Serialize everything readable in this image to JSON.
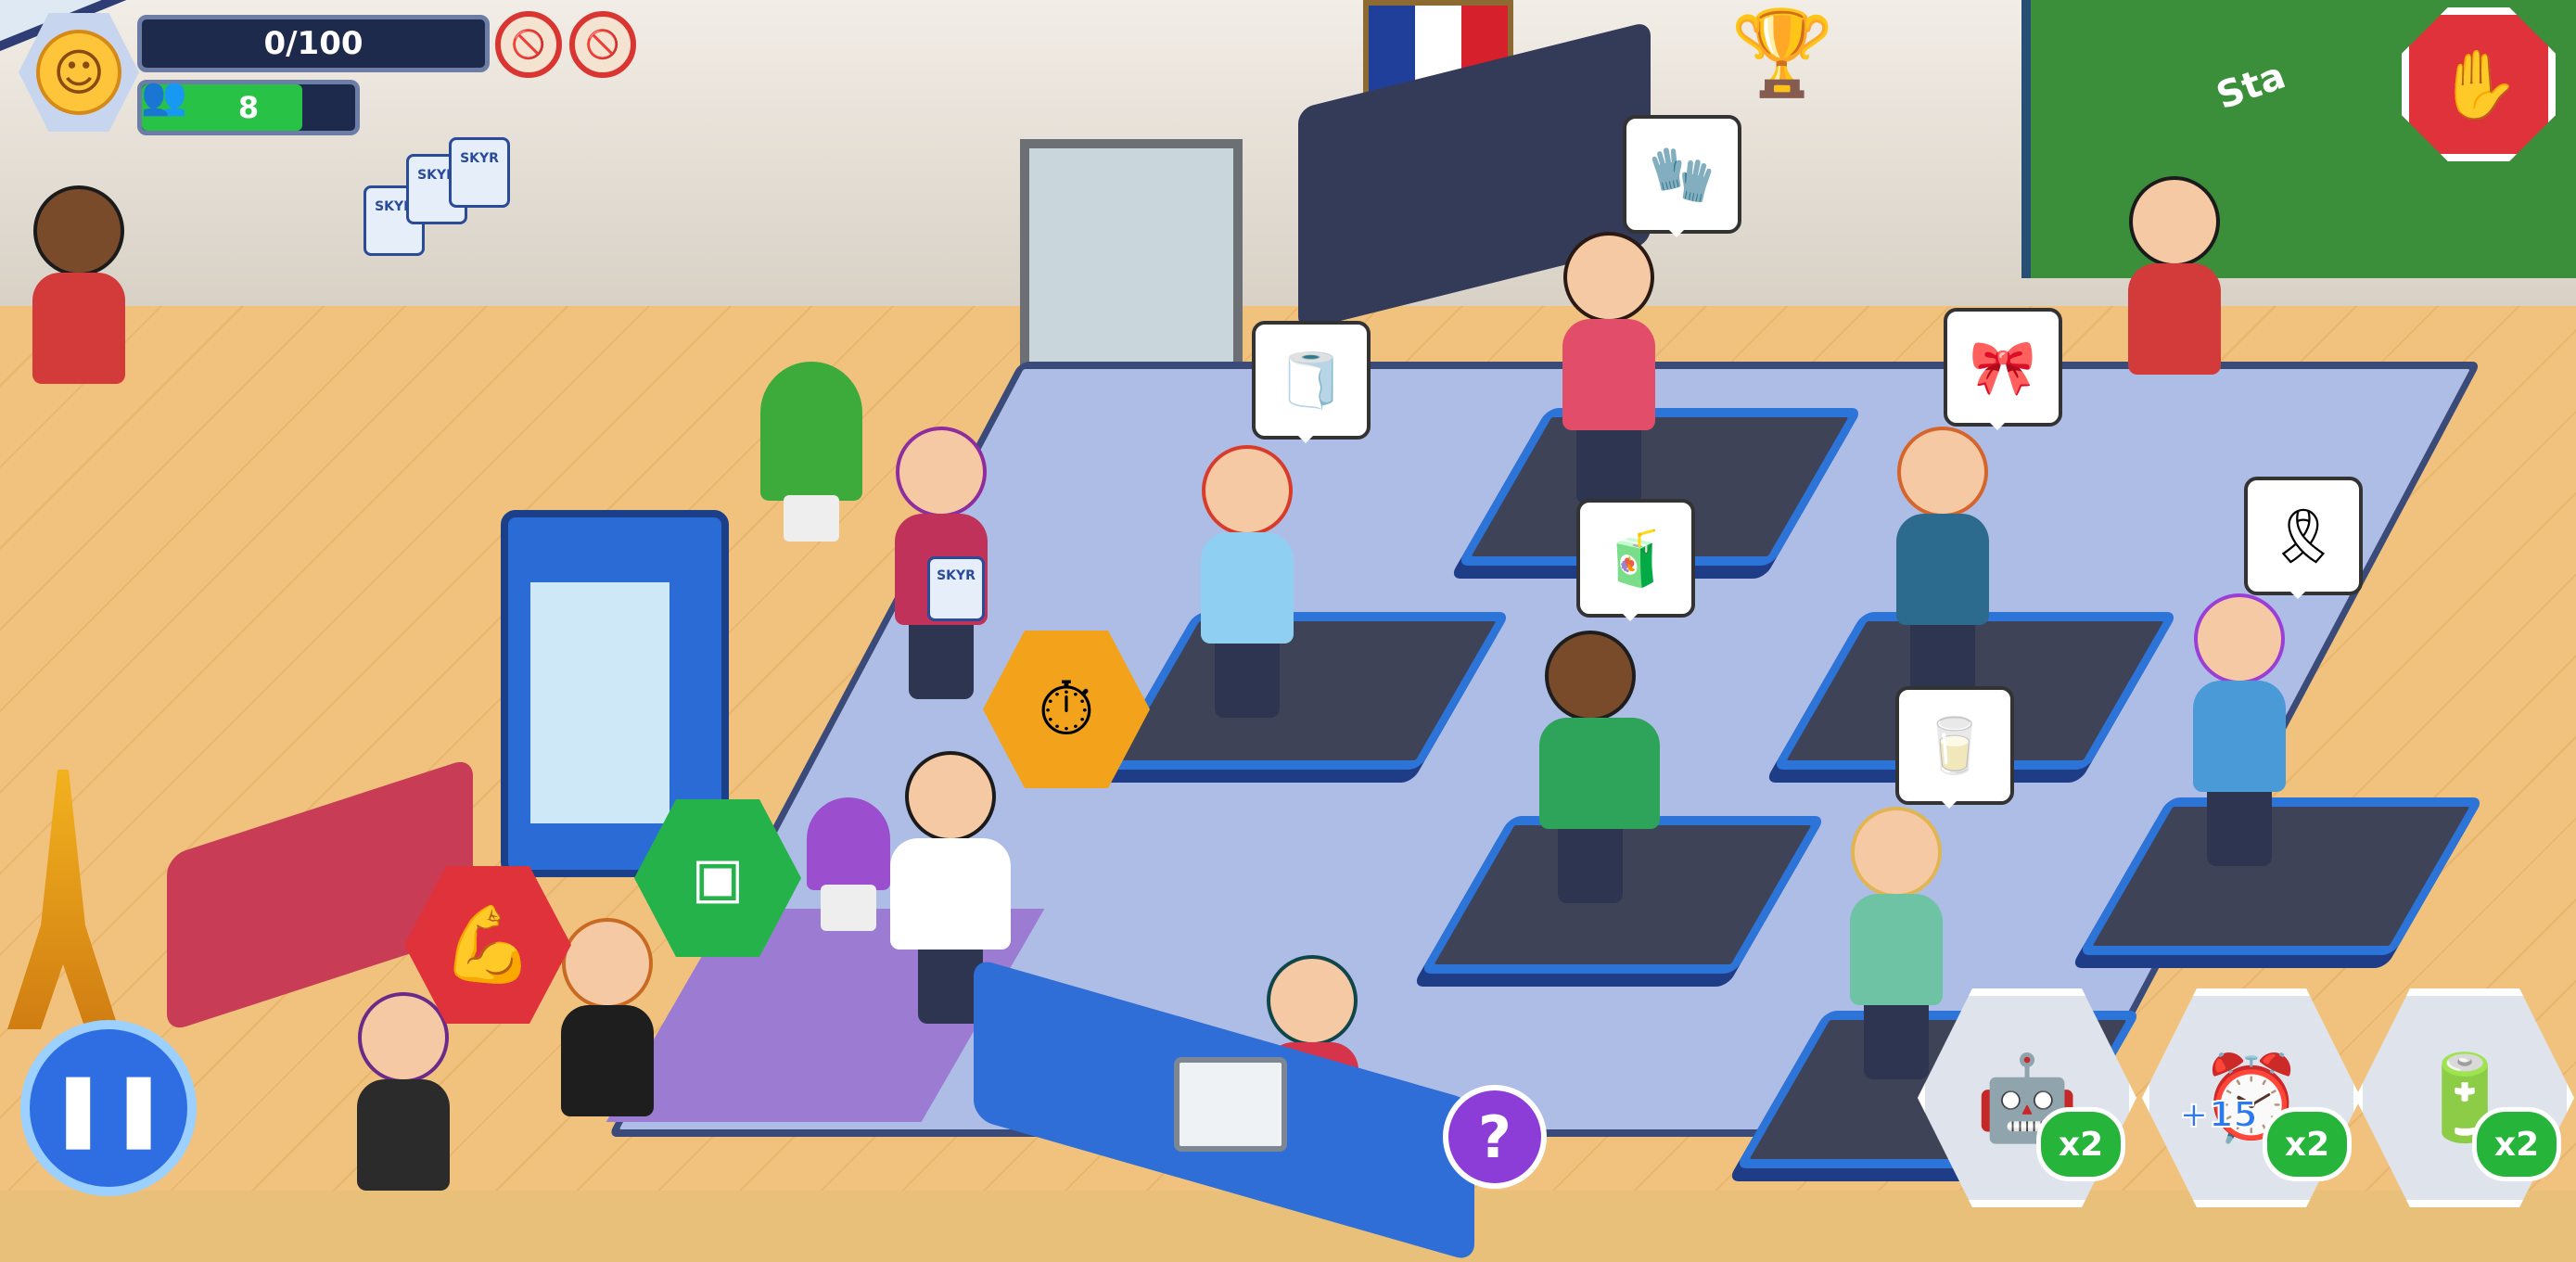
{
  "hud": {
    "xp_text": "0/100",
    "xp_progress": 0,
    "visitor_count": "8",
    "visitor_progress": 0.75,
    "avatar_icon": "smiley-face-icon",
    "no_entry_icons": [
      "no-visitor-icon",
      "no-card-icon"
    ]
  },
  "controls": {
    "stop_icon": "hand-stop-icon",
    "pause_icon": "pause-icon",
    "help_label": "?"
  },
  "skill_badges": [
    {
      "name": "strength-badge",
      "color": "#e0323b",
      "icon": "muscle-arm-icon"
    },
    {
      "name": "abs-badge",
      "color": "#26b24b",
      "icon": "abs-torso-icon"
    },
    {
      "name": "cardio-timer-badge",
      "color": "#f2a31b",
      "icon": "stopwatch-plus-icon"
    }
  ],
  "boosters": [
    {
      "name": "robot-vacuum-booster",
      "icon": "robot-icon",
      "multiplier": "x2",
      "extra": ""
    },
    {
      "name": "time-booster",
      "icon": "alarm-clock-icon",
      "multiplier": "x2",
      "extra": "+15"
    },
    {
      "name": "energy-drink-booster",
      "icon": "energy-canister-icon",
      "multiplier": "x2",
      "extra": ""
    }
  ],
  "request_bubbles": [
    {
      "name": "gloves-request",
      "icon": "gym-gloves-icon",
      "glyph": "🧤"
    },
    {
      "name": "towel-request",
      "icon": "towel-roll-icon",
      "glyph": "🧻"
    },
    {
      "name": "tape-request",
      "icon": "kinesio-tape-icon",
      "glyph": "🎀"
    },
    {
      "name": "drink-request",
      "icon": "smoothie-bottle-icon",
      "glyph": "🧃"
    },
    {
      "name": "belt-request",
      "icon": "weight-belt-icon",
      "glyph": "🎗"
    },
    {
      "name": "skyr-request",
      "icon": "skyr-yogurt-icon",
      "glyph": "🥛"
    }
  ],
  "products": {
    "yogurt_label": "SKYR"
  },
  "scene": {
    "field_text": "Sta",
    "colors": {
      "flag_blue": "#1f3f9a",
      "flag_white": "#ffffff",
      "flag_red": "#d6202c",
      "accent_green": "#27c246",
      "treadmill_blue": "#2c74d8"
    }
  }
}
